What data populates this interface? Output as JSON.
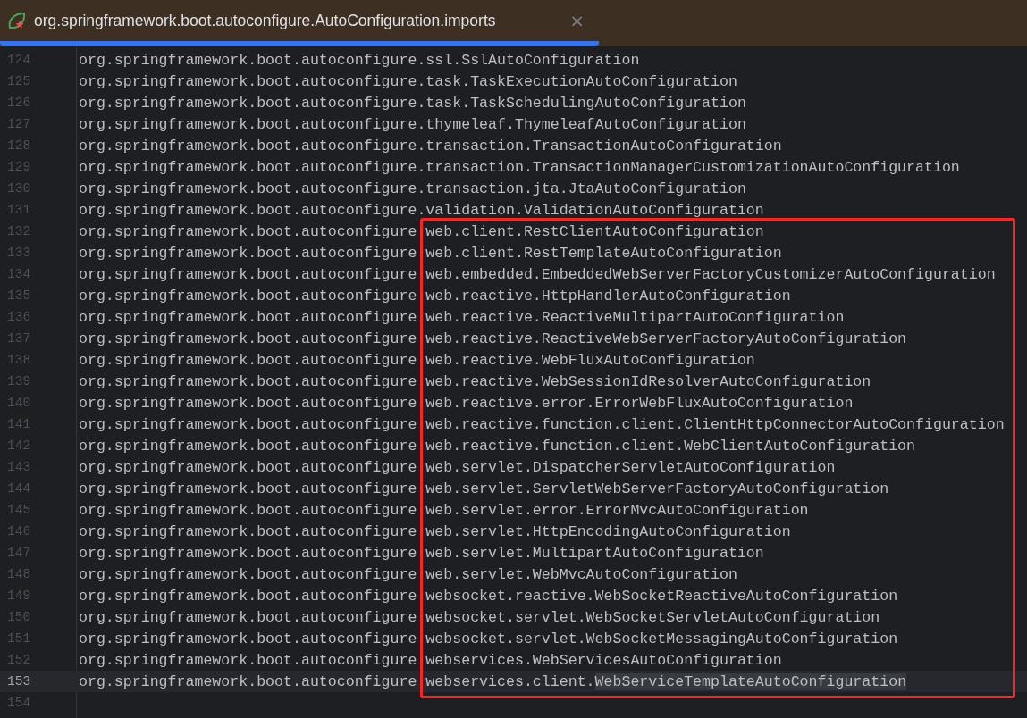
{
  "tab": {
    "title": "org.springframework.boot.autoconfigure.AutoConfiguration.imports",
    "close": "×",
    "selected": true
  },
  "editor": {
    "lines": [
      {
        "number": "124",
        "text": "org.springframework.boot.autoconfigure.ssl.SslAutoConfiguration",
        "current": false
      },
      {
        "number": "125",
        "text": "org.springframework.boot.autoconfigure.task.TaskExecutionAutoConfiguration",
        "current": false
      },
      {
        "number": "126",
        "text": "org.springframework.boot.autoconfigure.task.TaskSchedulingAutoConfiguration",
        "current": false
      },
      {
        "number": "127",
        "text": "org.springframework.boot.autoconfigure.thymeleaf.ThymeleafAutoConfiguration",
        "current": false
      },
      {
        "number": "128",
        "text": "org.springframework.boot.autoconfigure.transaction.TransactionAutoConfiguration",
        "current": false
      },
      {
        "number": "129",
        "text": "org.springframework.boot.autoconfigure.transaction.TransactionManagerCustomizationAutoConfiguration",
        "current": false
      },
      {
        "number": "130",
        "text": "org.springframework.boot.autoconfigure.transaction.jta.JtaAutoConfiguration",
        "current": false
      },
      {
        "number": "131",
        "text": "org.springframework.boot.autoconfigure.validation.ValidationAutoConfiguration",
        "current": false
      },
      {
        "number": "132",
        "text": "org.springframework.boot.autoconfigure.web.client.RestClientAutoConfiguration",
        "current": false
      },
      {
        "number": "133",
        "text": "org.springframework.boot.autoconfigure.web.client.RestTemplateAutoConfiguration",
        "current": false
      },
      {
        "number": "134",
        "text": "org.springframework.boot.autoconfigure.web.embedded.EmbeddedWebServerFactoryCustomizerAutoConfiguration",
        "current": false
      },
      {
        "number": "135",
        "text": "org.springframework.boot.autoconfigure.web.reactive.HttpHandlerAutoConfiguration",
        "current": false
      },
      {
        "number": "136",
        "text": "org.springframework.boot.autoconfigure.web.reactive.ReactiveMultipartAutoConfiguration",
        "current": false
      },
      {
        "number": "137",
        "text": "org.springframework.boot.autoconfigure.web.reactive.ReactiveWebServerFactoryAutoConfiguration",
        "current": false
      },
      {
        "number": "138",
        "text": "org.springframework.boot.autoconfigure.web.reactive.WebFluxAutoConfiguration",
        "current": false
      },
      {
        "number": "139",
        "text": "org.springframework.boot.autoconfigure.web.reactive.WebSessionIdResolverAutoConfiguration",
        "current": false
      },
      {
        "number": "140",
        "text": "org.springframework.boot.autoconfigure.web.reactive.error.ErrorWebFluxAutoConfiguration",
        "current": false
      },
      {
        "number": "141",
        "text": "org.springframework.boot.autoconfigure.web.reactive.function.client.ClientHttpConnectorAutoConfiguration",
        "current": false
      },
      {
        "number": "142",
        "text": "org.springframework.boot.autoconfigure.web.reactive.function.client.WebClientAutoConfiguration",
        "current": false
      },
      {
        "number": "143",
        "text": "org.springframework.boot.autoconfigure.web.servlet.DispatcherServletAutoConfiguration",
        "current": false
      },
      {
        "number": "144",
        "text": "org.springframework.boot.autoconfigure.web.servlet.ServletWebServerFactoryAutoConfiguration",
        "current": false
      },
      {
        "number": "145",
        "text": "org.springframework.boot.autoconfigure.web.servlet.error.ErrorMvcAutoConfiguration",
        "current": false
      },
      {
        "number": "146",
        "text": "org.springframework.boot.autoconfigure.web.servlet.HttpEncodingAutoConfiguration",
        "current": false
      },
      {
        "number": "147",
        "text": "org.springframework.boot.autoconfigure.web.servlet.MultipartAutoConfiguration",
        "current": false
      },
      {
        "number": "148",
        "text": "org.springframework.boot.autoconfigure.web.servlet.WebMvcAutoConfiguration",
        "current": false
      },
      {
        "number": "149",
        "text": "org.springframework.boot.autoconfigure.websocket.reactive.WebSocketReactiveAutoConfiguration",
        "current": false
      },
      {
        "number": "150",
        "text": "org.springframework.boot.autoconfigure.websocket.servlet.WebSocketServletAutoConfiguration",
        "current": false
      },
      {
        "number": "151",
        "text": "org.springframework.boot.autoconfigure.websocket.servlet.WebSocketMessagingAutoConfiguration",
        "current": false
      },
      {
        "number": "152",
        "text": "org.springframework.boot.autoconfigure.webservices.WebServicesAutoConfiguration",
        "current": false
      },
      {
        "number": "153",
        "text": "org.springframework.boot.autoconfigure.webservices.client.",
        "selection": "WebServiceTemplateAutoConfiguration",
        "current": true
      },
      {
        "number": "154",
        "current": false
      }
    ]
  }
}
